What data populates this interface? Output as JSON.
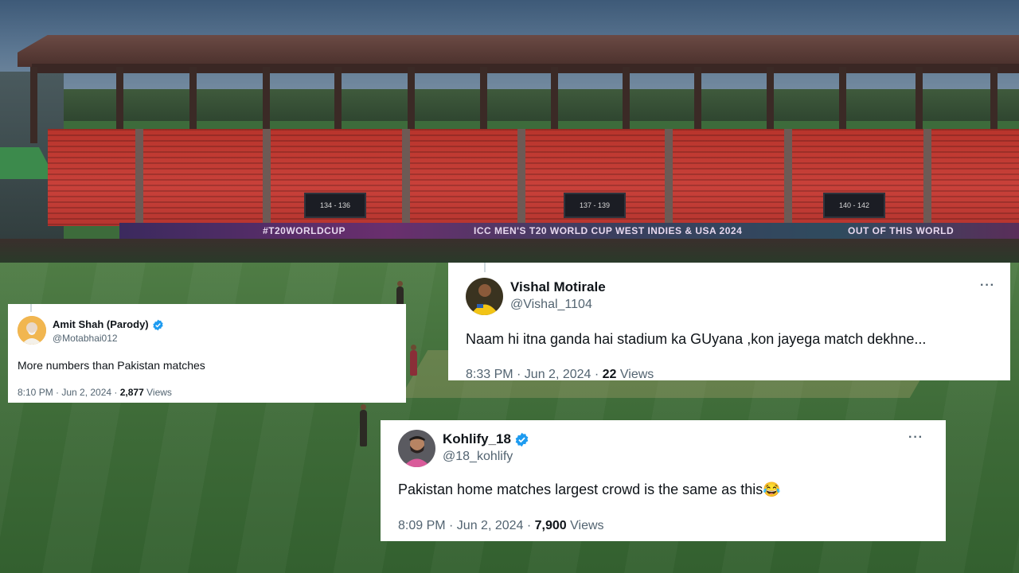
{
  "scene": {
    "stadium_banner": [
      "#T20WORLDCUP",
      "ICC MEN'S T20 WORLD CUP WEST INDIES & USA 2024",
      "OUT OF THIS WORLD"
    ],
    "scoreboards": [
      "134 - 136",
      "137 - 139",
      "140 - 142"
    ]
  },
  "tweets": [
    {
      "name": "Amit Shah (Parody)",
      "verified": true,
      "handle": "@Motabhai012",
      "text": "More numbers than Pakistan matches",
      "time": "8:10 PM · Jun 2, 2024 · ",
      "views_count": "2,877",
      "views_label": " Views",
      "avatar_icon": "man-portrait-avatar"
    },
    {
      "name": "Vishal Motirale",
      "verified": false,
      "handle": "@Vishal_1104",
      "text": "Naam hi itna ganda hai stadium ka GUyana ,kon jayega match dekhne...",
      "time": "8:33 PM · Jun 2, 2024 · ",
      "views_count": "22",
      "views_label": " Views",
      "more_glyph": "···",
      "avatar_icon": "cricketer-yellow-jersey-avatar"
    },
    {
      "name": "Kohlify_18",
      "verified": true,
      "handle": "@18_kohlify",
      "text": "Pakistan home matches largest crowd is the same as this😂",
      "time": "8:09 PM · Jun 2, 2024 · ",
      "views_count": "7,900",
      "views_label": " Views",
      "more_glyph": "···",
      "avatar_icon": "bearded-man-avatar"
    }
  ],
  "colors": {
    "verified_blue": "#1d9bf0",
    "secondary_text": "#536471",
    "primary_text": "#0f1419"
  }
}
